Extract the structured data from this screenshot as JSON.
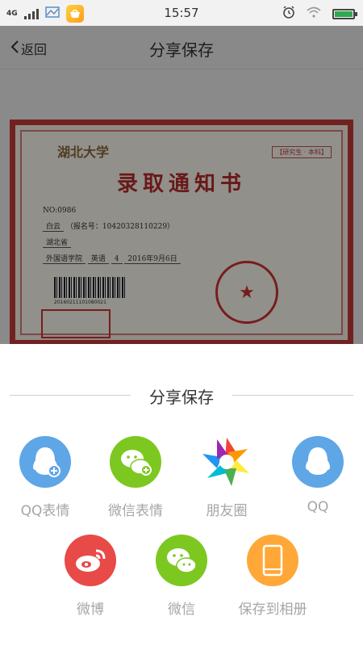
{
  "status_bar": {
    "network": "4G",
    "time": "15:57"
  },
  "nav": {
    "back_label": "返回",
    "title": "分享保存"
  },
  "certificate": {
    "university": "湖北大学",
    "stamp_label": "【研究生 · 本科】",
    "title": "录取通知书",
    "serial": "NO:0986",
    "student_name": "白云",
    "reg_no": "（报名号：10420328110229）",
    "province": "湖北省",
    "college": "外国语学院",
    "major": "英语",
    "years": "4",
    "report_date": "2016年9月6日",
    "barcode_text": "20160211101080021"
  },
  "share": {
    "title": "分享保存",
    "items": [
      {
        "label": "QQ表情",
        "icon": "qq-emoji-icon",
        "color": "#5fa6e6"
      },
      {
        "label": "微信表情",
        "icon": "wechat-emoji-icon",
        "color": "#7cc820"
      },
      {
        "label": "朋友圈",
        "icon": "moments-icon",
        "color": "#ffffff"
      },
      {
        "label": "QQ",
        "icon": "qq-icon",
        "color": "#5fa6e6"
      },
      {
        "label": "微博",
        "icon": "weibo-icon",
        "color": "#e84a48"
      },
      {
        "label": "微信",
        "icon": "wechat-icon",
        "color": "#7cc820"
      },
      {
        "label": "保存到相册",
        "icon": "save-album-icon",
        "color": "#ffa838"
      }
    ]
  }
}
